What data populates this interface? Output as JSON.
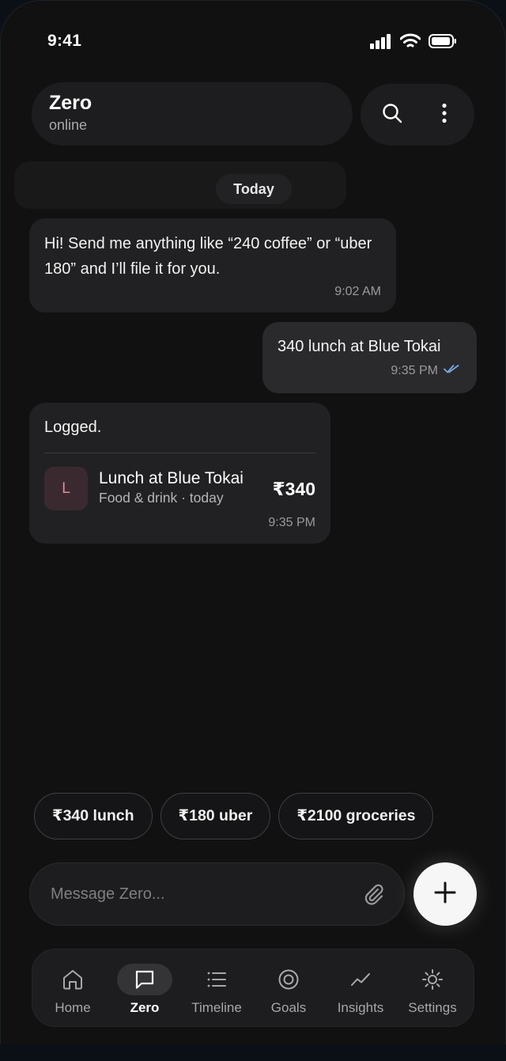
{
  "status_bar": {
    "time": "9:41"
  },
  "header": {
    "name": "Zero",
    "status": "online",
    "search_icon": "search-icon",
    "more_icon": "more-vertical-icon"
  },
  "chat": {
    "date_divider": "Today",
    "messages": [
      {
        "direction": "incoming",
        "text": "Hi! Send me anything like “240 coffee” or “uber 180” and I’ll file it for you.",
        "time": "9:02 AM"
      },
      {
        "direction": "outgoing",
        "text": "340 lunch at Blue Tokai",
        "time": "9:35 PM",
        "status_icon": "double-check-icon"
      },
      {
        "direction": "incoming",
        "text": "Logged.",
        "time": "9:35 PM",
        "expense": {
          "avatar_letter": "L",
          "title": "Lunch at Blue Tokai",
          "subtitle": "Food & drink · today",
          "amount": "₹340"
        }
      }
    ]
  },
  "quick_chips": [
    "₹340 lunch",
    "₹180 uber",
    "₹2100 groceries"
  ],
  "composer": {
    "placeholder": "Message Zero...",
    "attach_icon": "paperclip-icon",
    "add_icon": "plus-icon"
  },
  "bottom_nav": {
    "items": [
      {
        "label": "Home",
        "icon": "home-icon"
      },
      {
        "label": "Zero",
        "icon": "chat-icon",
        "active": true
      },
      {
        "label": "Timeline",
        "icon": "list-icon"
      },
      {
        "label": "Goals",
        "icon": "target-icon"
      },
      {
        "label": "Insights",
        "icon": "trend-icon"
      },
      {
        "label": "Settings",
        "icon": "sun-gear-icon"
      }
    ]
  },
  "colors": {
    "background": "#111112",
    "surface": "#1d1d1f",
    "bubble_in": "#212123",
    "bubble_out": "#2a2a2d",
    "read_tick": "#7aa7e0",
    "avatar_bg": "#3a2a2f",
    "avatar_fg": "#e58a9a"
  }
}
